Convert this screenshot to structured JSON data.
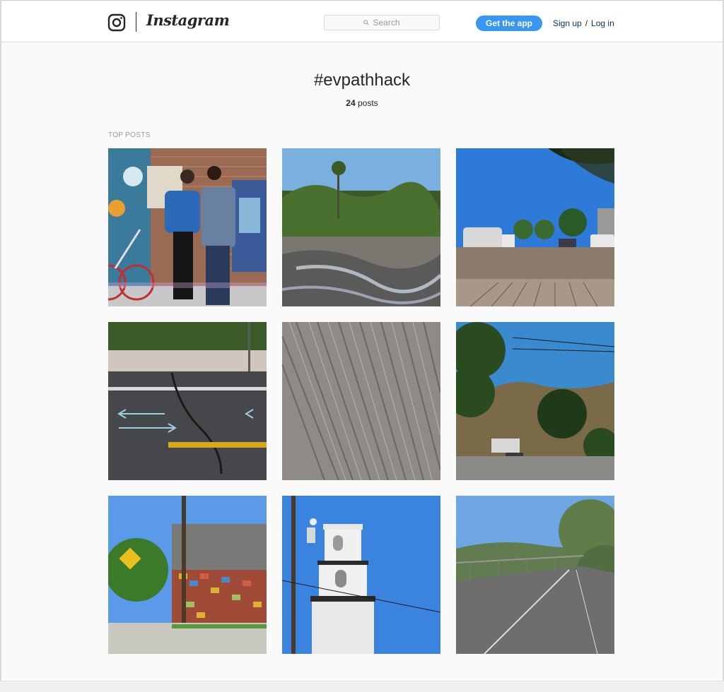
{
  "header": {
    "wordmark": "Instagram",
    "search_placeholder": "Search",
    "get_app_label": "Get the app",
    "signup_label": "Sign up",
    "separator": "/",
    "login_label": "Log in",
    "accent_color": "#3897f0"
  },
  "tag": {
    "title": "#evpathhack",
    "post_count": "24",
    "post_count_suffix": "posts"
  },
  "section": {
    "top_posts_label": "TOP POSTS"
  },
  "posts": [
    {
      "subject": "two women with bicycle at mural wall"
    },
    {
      "subject": "river bed with palm trees"
    },
    {
      "subject": "street with parked cars"
    },
    {
      "subject": "cracked asphalt bike path"
    },
    {
      "subject": "textured concrete closeup"
    },
    {
      "subject": "tree-lined road with hills"
    },
    {
      "subject": "dead end sign by colorful building"
    },
    {
      "subject": "white bell tower"
    },
    {
      "subject": "bike path along fence"
    }
  ]
}
